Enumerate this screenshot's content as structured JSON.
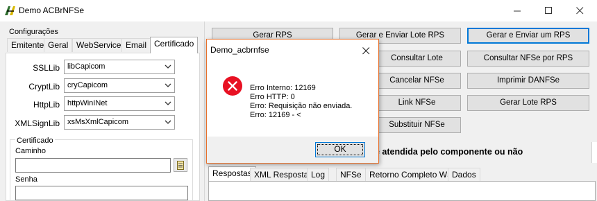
{
  "window": {
    "title": "Demo ACBrNFSe",
    "icon": "app-pen-icon"
  },
  "left": {
    "group_label": "Configurações",
    "tabs": [
      "Emitente",
      "Geral",
      "WebService",
      "Email",
      "Certificado"
    ],
    "active_tab": "Certificado",
    "fields": [
      {
        "label": "SSLLib",
        "value": "libCapicom"
      },
      {
        "label": "CryptLib",
        "value": "cryCapicom"
      },
      {
        "label": "HttpLib",
        "value": "httpWinINet"
      },
      {
        "label": "XMLSignLib",
        "value": "xsMsXmlCapicom"
      }
    ],
    "cert": {
      "title": "Certificado",
      "path_label": "Caminho",
      "path_value": "",
      "password_label": "Senha",
      "password_value": ""
    }
  },
  "right": {
    "buttons": {
      "gerar_rps": "Gerar RPS",
      "gerar_enviar_lote": "Gerar e Enviar Lote RPS",
      "gerar_enviar_um": "Gerar e Enviar um RPS",
      "consultar_lote": "Consultar Lote",
      "consultar_nfse_rps": "Consultar NFSe por RPS",
      "cancelar_nfse": "Cancelar NFSe",
      "imprimir_danfse": "Imprimir DANFSe",
      "link_nfse": "Link NFSe",
      "gerar_lote_rps": "Gerar Lote RPS",
      "substituir_nfse": "Substituir NFSe"
    },
    "status_text": "é atendida pelo componente ou não",
    "tabs": [
      "Respostas",
      "XML Resposta",
      "Log",
      "NFSe",
      "Retorno Completo WS",
      "Dados"
    ],
    "active_tab": "Respostas"
  },
  "dialog": {
    "title": "Demo_acbrnfse",
    "icon": "error-icon",
    "lines": [
      "Erro Interno: 12169",
      "Erro HTTP: 0",
      "Erro: Requisição não enviada.",
      "Erro: 12169 - <"
    ],
    "ok_label": "OK"
  },
  "colors": {
    "accent": "#0078d7",
    "dialog_border": "#e8702a",
    "error_red": "#e81123"
  }
}
